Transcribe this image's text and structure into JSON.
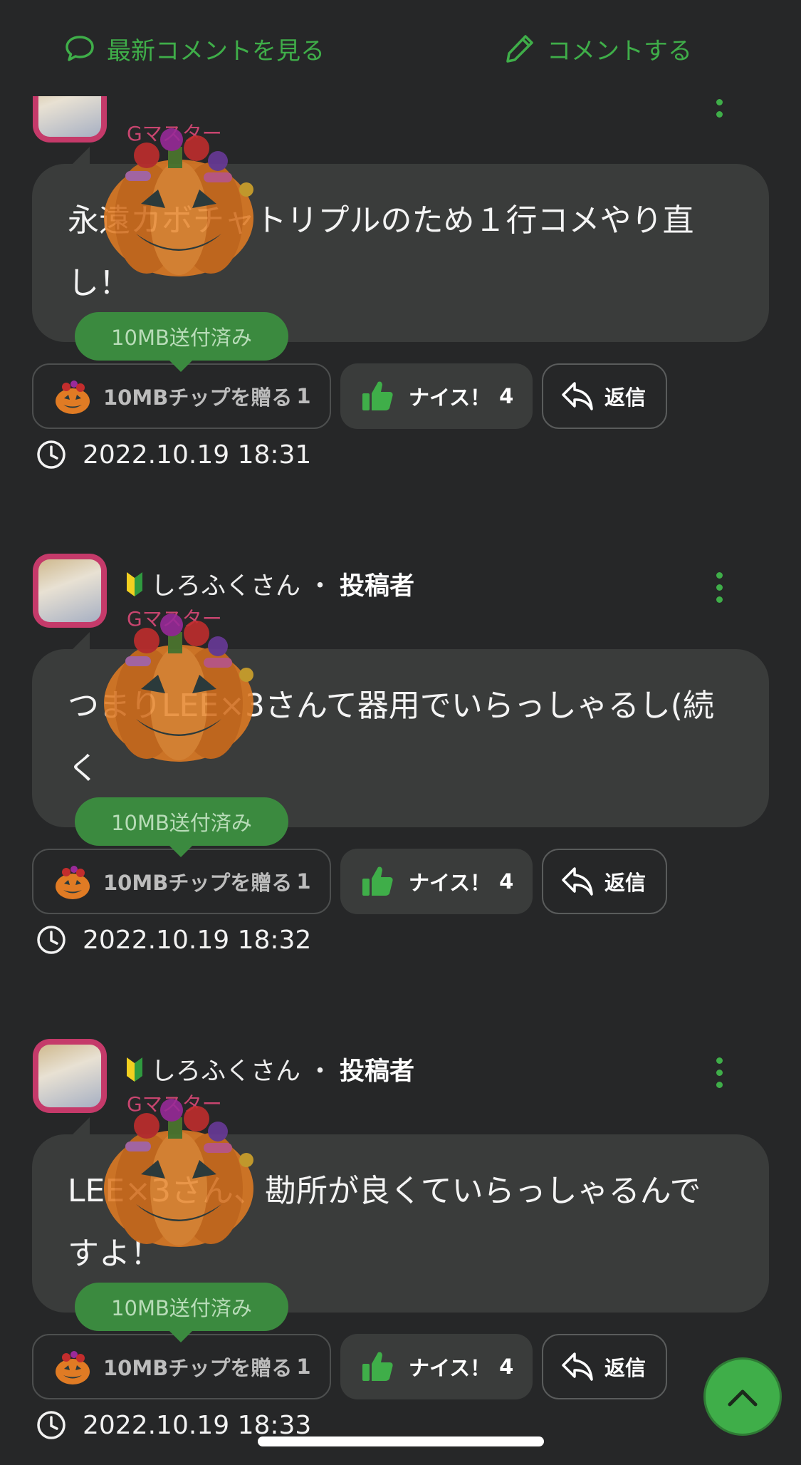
{
  "topbar": {
    "latest_comments": "最新コメントを見る",
    "post_comment": "コメントする"
  },
  "colors": {
    "accent": "#3fae49",
    "rank": "#c8456f",
    "bubble": "#3a3c3b",
    "background": "#262728"
  },
  "comments": [
    {
      "user": "",
      "separator": "",
      "poster_label": "",
      "rank": "Gマスター",
      "body_line1": "永遠カボチャトリプルのため１行コメやり直",
      "body_line2": "し！",
      "sent_badge": "10MB送付済み",
      "tip_button": "10MBチップを贈る",
      "tip_count": "1",
      "nice_label": "ナイス！",
      "nice_count": "4",
      "reply_label": "返信",
      "timestamp": "2022.10.19 18:31"
    },
    {
      "user": "しろふくさん",
      "separator": "・",
      "poster_label": "投稿者",
      "rank": "Gマスター",
      "body_line1": "つまりLEE×3さんて器用でいらっしゃるし(続",
      "body_line2": "く",
      "sent_badge": "10MB送付済み",
      "tip_button": "10MBチップを贈る",
      "tip_count": "1",
      "nice_label": "ナイス！",
      "nice_count": "4",
      "reply_label": "返信",
      "timestamp": "2022.10.19 18:32"
    },
    {
      "user": "しろふくさん",
      "separator": "・",
      "poster_label": "投稿者",
      "rank": "Gマスター",
      "body_line1": "LEE×3さん、勘所が良くていらっしゃるんで",
      "body_line2": "すよ！",
      "sent_badge": "10MB送付済み",
      "tip_button": "10MBチップを贈る",
      "tip_count": "1",
      "nice_label": "ナイス！",
      "nice_count": "4",
      "reply_label": "返信",
      "timestamp": "2022.10.19 18:33"
    }
  ],
  "icons": {
    "latest": "speech-bubble-icon",
    "comment": "pencil-icon",
    "beginner": "beginner-mark-icon",
    "more": "vertical-dots-icon",
    "nice": "thumbs-up-icon",
    "reply": "reply-arrow-icon",
    "clock": "clock-icon",
    "scroll_top": "chevron-up-icon",
    "pumpkin": "pumpkin-icon"
  }
}
